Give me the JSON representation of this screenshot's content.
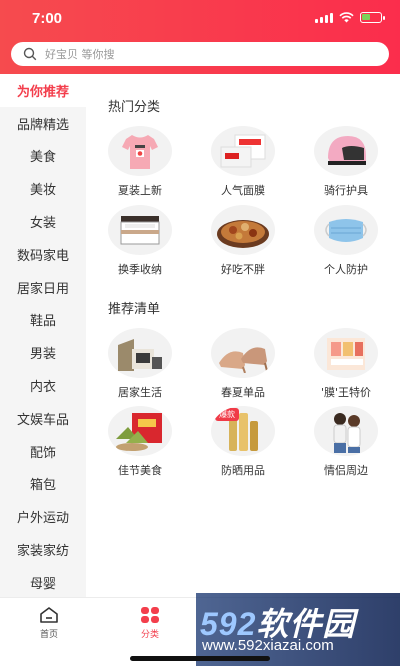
{
  "status": {
    "time": "7:00"
  },
  "search": {
    "placeholder": "好宝贝 等你搜"
  },
  "sidebar": {
    "items": [
      {
        "label": "为你推荐"
      },
      {
        "label": "品牌精选"
      },
      {
        "label": "美食"
      },
      {
        "label": "美妆"
      },
      {
        "label": "女装"
      },
      {
        "label": "数码家电"
      },
      {
        "label": "居家日用"
      },
      {
        "label": "鞋品"
      },
      {
        "label": "男装"
      },
      {
        "label": "内衣"
      },
      {
        "label": "文娱车品"
      },
      {
        "label": "配饰"
      },
      {
        "label": "箱包"
      },
      {
        "label": "户外运动"
      },
      {
        "label": "家装家纺"
      },
      {
        "label": "母婴"
      }
    ]
  },
  "hot": {
    "title": "热门分类",
    "items": [
      {
        "label": "夏装上新"
      },
      {
        "label": "人气面膜"
      },
      {
        "label": "骑行护具"
      },
      {
        "label": "换季收纳"
      },
      {
        "label": "好吃不胖"
      },
      {
        "label": "个人防护"
      }
    ]
  },
  "recommend": {
    "title": "推荐清单",
    "items": [
      {
        "label": "居家生活"
      },
      {
        "label": "春夏单品"
      },
      {
        "label": "'膜'王特价"
      },
      {
        "label": "佳节美食"
      },
      {
        "label": "防晒用品",
        "badge": "爆款"
      },
      {
        "label": "情侣周边"
      }
    ]
  },
  "tabbar": {
    "home": "首页",
    "category": "分类"
  },
  "watermark": {
    "title_num": "592",
    "title_text": "软件园",
    "url": "www.592xiazai.com"
  },
  "colors": {
    "accent": "#f33e4c",
    "header_start": "#f64b4e",
    "header_end": "#fb2d4c"
  }
}
